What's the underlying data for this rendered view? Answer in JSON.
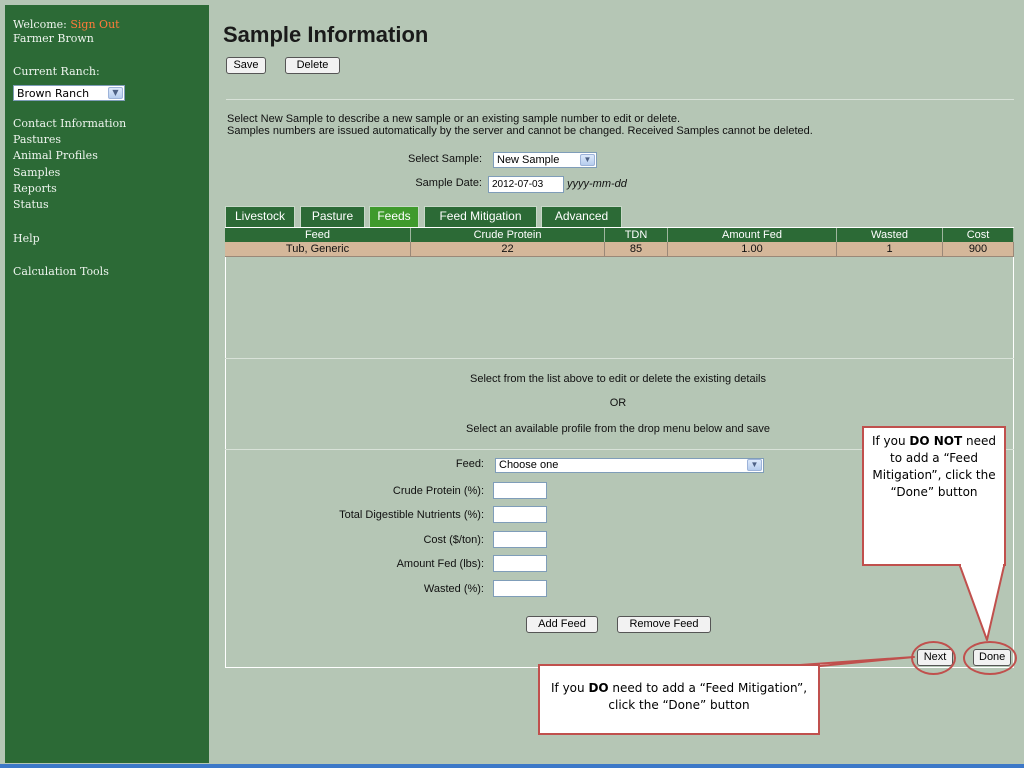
{
  "sidebar": {
    "welcome_label": "Welcome:",
    "sign_out_link": "Sign Out",
    "user_name": "Farmer Brown",
    "current_ranch_label": "Current Ranch:",
    "ranch_selected": "Brown Ranch",
    "menu": [
      {
        "label": "Contact Information"
      },
      {
        "label": "Pastures"
      },
      {
        "label": "Animal Profiles"
      },
      {
        "label": "Samples"
      },
      {
        "label": "Reports"
      },
      {
        "label": "Status"
      }
    ],
    "help": "Help",
    "calc_tools": "Calculation Tools"
  },
  "page": {
    "title": "Sample Information",
    "save_button": "Save",
    "delete_button": "Delete",
    "instructions_1": "Select New Sample to describe a new sample or an existing sample number to edit or delete.",
    "instructions_2": "Samples numbers are issued automatically by the server and cannot be changed. Received Samples cannot be deleted.",
    "select_sample_label": "Select Sample:",
    "select_sample_value": "New Sample",
    "sample_date_label": "Sample Date:",
    "sample_date_value": "2012-07-03",
    "sample_date_format": "yyyy-mm-dd"
  },
  "tabs": [
    {
      "label": "Livestock"
    },
    {
      "label": "Pasture"
    },
    {
      "label": "Feeds"
    },
    {
      "label": "Feed Mitigation"
    },
    {
      "label": "Advanced"
    }
  ],
  "feeds_table": {
    "columns": [
      "Feed",
      "Crude Protein",
      "TDN",
      "Amount Fed",
      "Wasted",
      "Cost"
    ],
    "rows": [
      [
        "Tub, Generic",
        "22",
        "85",
        "1.00",
        "1",
        "900"
      ]
    ]
  },
  "messages": {
    "select_list": "Select from the list above to edit or delete the existing details",
    "or": "OR",
    "select_profile": "Select an available profile from the drop menu below and save"
  },
  "form": {
    "feed_label": "Feed:",
    "feed_value": "Choose one",
    "crude_protein_label": "Crude Protein (%):",
    "tdn_label": "Total Digestible Nutrients (%):",
    "cost_label": "Cost ($/ton):",
    "amount_fed_label": "Amount Fed (lbs):",
    "wasted_label": "Wasted (%):",
    "crude_protein_value": "",
    "tdn_value": "",
    "cost_value": "",
    "amount_fed_value": "",
    "wasted_value": "",
    "add_feed_button": "Add Feed",
    "remove_feed_button": "Remove Feed",
    "next_button": "Next",
    "done_button": "Done"
  },
  "callouts": {
    "top_pre": "If you ",
    "top_bold": "DO NOT",
    "top_post": " need to add a “Feed Mitigation”, click the “Done” button",
    "bottom_pre": "If you ",
    "bottom_bold": "DO",
    "bottom_post": " need to add a “Feed Mitigation”, click the “Done” button"
  },
  "colors": {
    "sidebar_bg": "#2c6a36",
    "page_bg": "#b5c6b5",
    "active_tab": "#3f9a2c",
    "row_highlight": "#d4b79a",
    "link_accent": "#ff7a3a",
    "callout_border": "#c0504d"
  }
}
